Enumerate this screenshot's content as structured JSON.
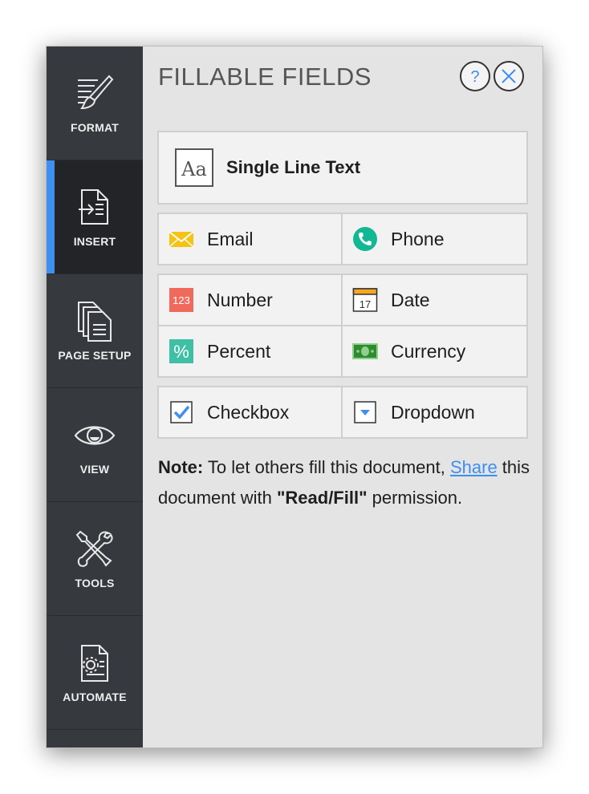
{
  "sidebar": {
    "items": [
      {
        "label": "FORMAT",
        "icon": "format-brush-icon"
      },
      {
        "label": "INSERT",
        "icon": "insert-document-icon",
        "active": true
      },
      {
        "label": "PAGE SETUP",
        "icon": "page-setup-icon"
      },
      {
        "label": "VIEW",
        "icon": "eye-icon"
      },
      {
        "label": "TOOLS",
        "icon": "tools-icon"
      },
      {
        "label": "AUTOMATE",
        "icon": "automate-gear-document-icon"
      }
    ]
  },
  "panel": {
    "title": "FILLABLE FIELDS",
    "help_symbol": "?",
    "close_symbol": "✕"
  },
  "fields": {
    "single_line_text": {
      "label": "Single Line Text",
      "icon": "text-aa-icon"
    },
    "email": {
      "label": "Email",
      "icon": "envelope-icon",
      "color": "#f5c216"
    },
    "phone": {
      "label": "Phone",
      "icon": "phone-icon",
      "color": "#12b893"
    },
    "number": {
      "label": "Number",
      "icon": "number-123-icon",
      "icon_text": "123",
      "color": "#f06a5b"
    },
    "date": {
      "label": "Date",
      "icon": "calendar-icon",
      "icon_text": "17",
      "color": "#f5a623"
    },
    "percent": {
      "label": "Percent",
      "icon": "percent-icon",
      "icon_text": "%",
      "color": "#3fc0a4"
    },
    "currency": {
      "label": "Currency",
      "icon": "banknote-icon",
      "color": "#2e8b2e"
    },
    "checkbox": {
      "label": "Checkbox",
      "icon": "checkbox-checked-icon",
      "color": "#3e8ff0"
    },
    "dropdown": {
      "label": "Dropdown",
      "icon": "dropdown-arrow-icon",
      "color": "#3e8ff0"
    }
  },
  "note": {
    "bold_prefix": "Note:",
    "text1": " To let others fill this document, ",
    "link": "Share",
    "text2": " this document with ",
    "bold_perm": "\"Read/Fill\"",
    "text3": " permission."
  }
}
